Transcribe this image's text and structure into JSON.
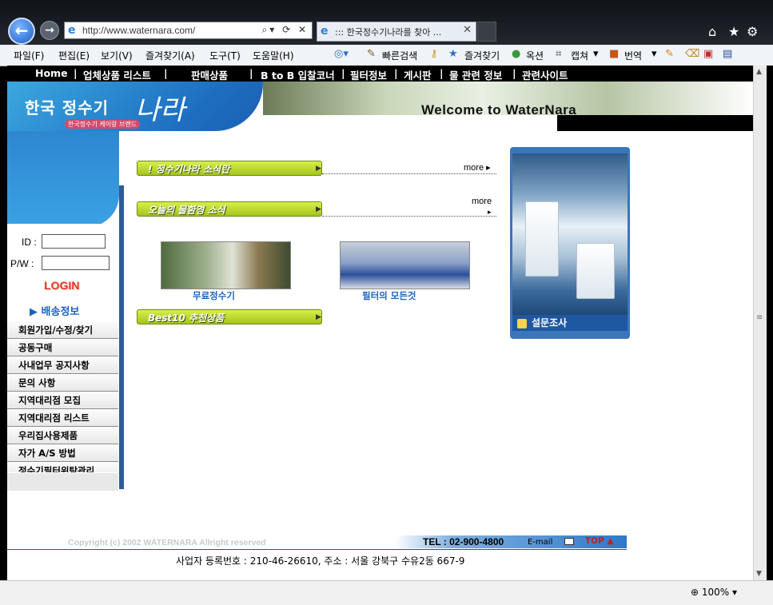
{
  "browser": {
    "address_url": "http://www.waternara.com/",
    "tab_title": "::: 한국정수기나라를 찾아 ...",
    "tab_close": "✕",
    "back_glyph": "←",
    "forward_glyph": "→",
    "address_tools": "⌕▾ ⟳ ✕",
    "menu": [
      "파일(F)",
      "편집(E)",
      "보기(V)",
      "즐겨찾기(A)",
      "도구(T)",
      "도움말(H)"
    ],
    "commands": [
      "빠른검색",
      "즐겨찾기",
      "옥션",
      "캡쳐",
      "번역"
    ],
    "zoom": "100%"
  },
  "site": {
    "nav": [
      "Home",
      "|",
      "업체상품 리스트",
      "|",
      "판매상품",
      "|",
      "B to B 입찰코너",
      "|",
      "필터정보",
      "|",
      "게시판",
      "|",
      "물 관련 정보",
      "|",
      "관련사이트"
    ],
    "logo": {
      "text": "한국 정수기",
      "script": "나라",
      "sub": "한국정수기 케이랑 브랜드"
    },
    "welcome": "Welcome to WaterNara",
    "login": {
      "id_label": "ID :",
      "pw_label": "P/W :",
      "button": "LOGIN",
      "delivery": "배송정보"
    },
    "side_menu": [
      "회원가입/수정/찾기",
      "공동구매",
      "사내업무 공지사항",
      "문의 사항",
      "지역대리점 모집",
      "지역대리점 리스트",
      "우리집사용제품",
      "자가 A/S 방법",
      "정수기필터위탁관리"
    ],
    "sections": {
      "news": {
        "label": "! 정수기나라 소식란",
        "more": "more ▸"
      },
      "env": {
        "label": "오늘의 물환경 소식",
        "more": "more",
        "more_arrow": "▸"
      },
      "best": {
        "label": "Best10 추천상품"
      }
    },
    "thumbs": [
      {
        "caption": "무료정수기"
      },
      {
        "caption": "필터의 모든것"
      }
    ],
    "promo_caption": "설문조사",
    "footer": {
      "copyright": "Copyright (c) 2002 WATERNARA Allright reserved",
      "tel": "TEL : 02-900-4800",
      "email": "E-mail",
      "top": "TOP ▲",
      "business": "사업자 등록번호 : 210-46-26610, 주소 : 서울 강북구 수유2동 667-9"
    }
  }
}
